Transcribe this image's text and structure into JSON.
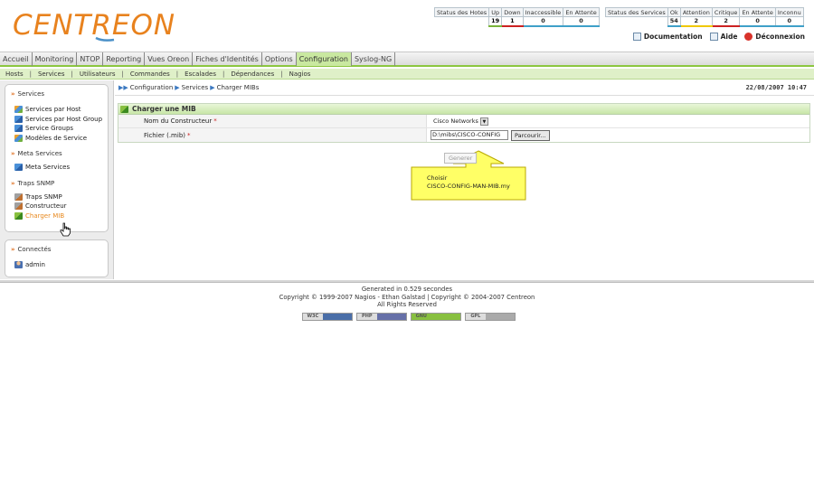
{
  "header": {
    "logo_text": "CENTREON",
    "hosts_status": {
      "headers": [
        "Status des Hotes",
        "Up",
        "Down",
        "Inaccessible",
        "En Attente"
      ],
      "values": [
        "19",
        "1",
        "0",
        "0"
      ]
    },
    "services_status": {
      "headers": [
        "Status des Services",
        "Ok",
        "Attention",
        "Critique",
        "En Attente",
        "Inconnu"
      ],
      "values": [
        "54",
        "2",
        "2",
        "0",
        "0"
      ]
    },
    "links": {
      "documentation": "Documentation",
      "help": "Aide",
      "logout": "Déconnexion"
    }
  },
  "main_menu": {
    "items": [
      {
        "label": "Accueil"
      },
      {
        "label": "Monitoring"
      },
      {
        "label": "NTOP"
      },
      {
        "label": "Reporting"
      },
      {
        "label": "Vues Oreon"
      },
      {
        "label": "Fiches d'Identités"
      },
      {
        "label": "Options"
      },
      {
        "label": "Configuration"
      },
      {
        "label": "Syslog-NG"
      }
    ],
    "active": "Configuration"
  },
  "sub_menu": {
    "items": [
      "Hosts",
      "Services",
      "Utilisateurs",
      "Commandes",
      "Escalades",
      "Dépendances",
      "Nagios"
    ]
  },
  "sidebar": {
    "sections": [
      {
        "title": "Services",
        "items": [
          "Services par Host",
          "Services par Host Group",
          "Service Groups",
          "Modèles de Service"
        ]
      },
      {
        "title": "Meta Services",
        "items": [
          "Meta Services"
        ]
      },
      {
        "title": "Traps SNMP",
        "items": [
          "Traps SNMP",
          "Constructeur",
          "Charger MIB"
        ]
      }
    ],
    "connected": {
      "title": "Connectés",
      "users": [
        "admin"
      ]
    }
  },
  "breadcrumb": [
    "Configuration",
    "Services",
    "Charger MIBs"
  ],
  "datetime": "22/08/2007 10:47",
  "form": {
    "title": "Charger une MIB",
    "manufacturer_label": "Nom du Constructeur",
    "manufacturer_value": "Cisco Networks",
    "file_label": "Fichier (.mib)",
    "file_value": "D:\\mibs\\CISCO-CONFIG",
    "browse_label": "Parcourir...",
    "required_mark": "*"
  },
  "generate_label": "Generer",
  "callout": {
    "line1": "Choisir",
    "line2": "CISCO-CONFIG-MAN-MIB.my"
  },
  "footer": {
    "line1": "Generated in 0.529 secondes",
    "line2": "Copyright © 1999-2007 Nagios - Ethan Galstad | Copyright © 2004-2007 Centreon",
    "line3": "All Rights Reserved"
  },
  "colors": {
    "accent_green": "#8cc63f",
    "logo_orange": "#e8821e",
    "logo_blue": "#4a90c8",
    "callout_yellow": "#ffff66"
  }
}
